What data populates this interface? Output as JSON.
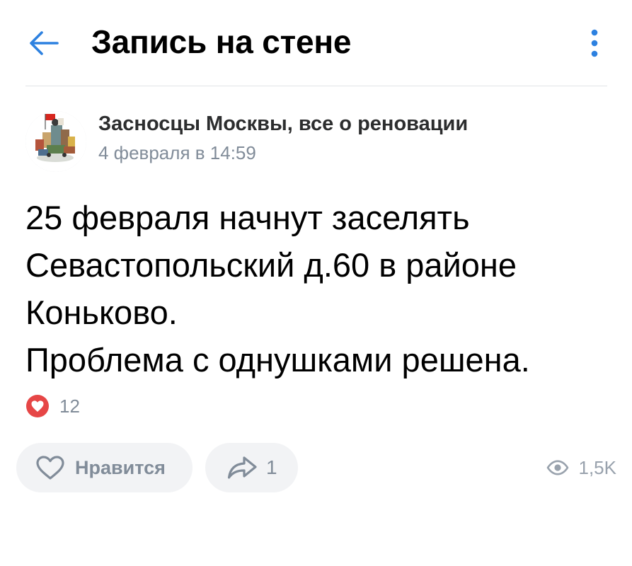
{
  "header": {
    "title": "Запись на стене",
    "back_icon": "arrow-left-icon",
    "more_icon": "more-vertical-icon",
    "accent_color": "#2d81e0"
  },
  "post": {
    "author": "Засносцы Москвы, все о реновации",
    "date": "4 февраля в 14:59",
    "avatar_icon": "community-avatar-icon",
    "text_lines": [
      "25 февраля начнут заселять",
      "Севастопольский д.60 в районе",
      "Коньково.",
      "Проблема с однушками решена."
    ]
  },
  "reactions": {
    "icon": "heart-reaction-icon",
    "count": "12",
    "color": "#e64646"
  },
  "actions": {
    "like_label": "Нравится",
    "like_icon": "heart-outline-icon",
    "share_count": "1",
    "share_icon": "share-arrow-icon",
    "views_icon": "eye-icon",
    "views_count": "1,5K"
  }
}
